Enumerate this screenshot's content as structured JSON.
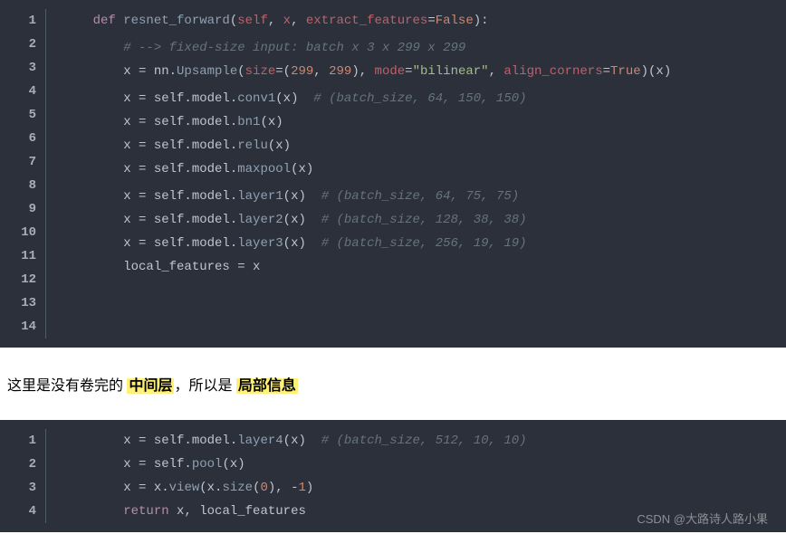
{
  "block1": {
    "gutter": [
      "1",
      "2",
      "3",
      "4",
      "5",
      "6",
      "7",
      "8",
      "9",
      "10",
      "11",
      "12",
      "13",
      "14"
    ],
    "lines": [
      [
        {
          "cls": "tok-default",
          "t": "    "
        },
        {
          "cls": "tok-kw",
          "t": "def "
        },
        {
          "cls": "tok-fn",
          "t": "resnet_forward"
        },
        {
          "cls": "tok-default",
          "t": "("
        },
        {
          "cls": "tok-var",
          "t": "self"
        },
        {
          "cls": "tok-default",
          "t": ", "
        },
        {
          "cls": "tok-var",
          "t": "x"
        },
        {
          "cls": "tok-default",
          "t": ", "
        },
        {
          "cls": "tok-var",
          "t": "extract_features"
        },
        {
          "cls": "tok-op",
          "t": "="
        },
        {
          "cls": "tok-bool",
          "t": "False"
        },
        {
          "cls": "tok-default",
          "t": "):"
        }
      ],
      [
        {
          "cls": "tok-default",
          "t": ""
        }
      ],
      [
        {
          "cls": "tok-default",
          "t": "        "
        },
        {
          "cls": "tok-com",
          "t": "# --> fixed-size input: batch x 3 x 299 x 299"
        }
      ],
      [
        {
          "cls": "tok-default",
          "t": "        x "
        },
        {
          "cls": "tok-op",
          "t": "="
        },
        {
          "cls": "tok-default",
          "t": " nn."
        },
        {
          "cls": "tok-call",
          "t": "Upsample"
        },
        {
          "cls": "tok-default",
          "t": "("
        },
        {
          "cls": "tok-var",
          "t": "size"
        },
        {
          "cls": "tok-op",
          "t": "="
        },
        {
          "cls": "tok-default",
          "t": "("
        },
        {
          "cls": "tok-num",
          "t": "299"
        },
        {
          "cls": "tok-default",
          "t": ", "
        },
        {
          "cls": "tok-num",
          "t": "299"
        },
        {
          "cls": "tok-default",
          "t": "), "
        },
        {
          "cls": "tok-var",
          "t": "mode"
        },
        {
          "cls": "tok-op",
          "t": "="
        },
        {
          "cls": "tok-str",
          "t": "\"bilinear\""
        },
        {
          "cls": "tok-default",
          "t": ", "
        },
        {
          "cls": "tok-var",
          "t": "align_corners"
        },
        {
          "cls": "tok-op",
          "t": "="
        },
        {
          "cls": "tok-bool",
          "t": "True"
        },
        {
          "cls": "tok-default",
          "t": ")(x)"
        }
      ],
      [
        {
          "cls": "tok-default",
          "t": ""
        }
      ],
      [
        {
          "cls": "tok-default",
          "t": "        x "
        },
        {
          "cls": "tok-op",
          "t": "="
        },
        {
          "cls": "tok-default",
          "t": " self.model."
        },
        {
          "cls": "tok-call",
          "t": "conv1"
        },
        {
          "cls": "tok-default",
          "t": "(x)  "
        },
        {
          "cls": "tok-com",
          "t": "# (batch_size, 64, 150, 150)"
        }
      ],
      [
        {
          "cls": "tok-default",
          "t": "        x "
        },
        {
          "cls": "tok-op",
          "t": "="
        },
        {
          "cls": "tok-default",
          "t": " self.model."
        },
        {
          "cls": "tok-call",
          "t": "bn1"
        },
        {
          "cls": "tok-default",
          "t": "(x)"
        }
      ],
      [
        {
          "cls": "tok-default",
          "t": "        x "
        },
        {
          "cls": "tok-op",
          "t": "="
        },
        {
          "cls": "tok-default",
          "t": " self.model."
        },
        {
          "cls": "tok-call",
          "t": "relu"
        },
        {
          "cls": "tok-default",
          "t": "(x)"
        }
      ],
      [
        {
          "cls": "tok-default",
          "t": "        x "
        },
        {
          "cls": "tok-op",
          "t": "="
        },
        {
          "cls": "tok-default",
          "t": " self.model."
        },
        {
          "cls": "tok-call",
          "t": "maxpool"
        },
        {
          "cls": "tok-default",
          "t": "(x)"
        }
      ],
      [
        {
          "cls": "tok-default",
          "t": ""
        }
      ],
      [
        {
          "cls": "tok-default",
          "t": "        x "
        },
        {
          "cls": "tok-op",
          "t": "="
        },
        {
          "cls": "tok-default",
          "t": " self.model."
        },
        {
          "cls": "tok-call",
          "t": "layer1"
        },
        {
          "cls": "tok-default",
          "t": "(x)  "
        },
        {
          "cls": "tok-com",
          "t": "# (batch_size, 64, 75, 75)"
        }
      ],
      [
        {
          "cls": "tok-default",
          "t": "        x "
        },
        {
          "cls": "tok-op",
          "t": "="
        },
        {
          "cls": "tok-default",
          "t": " self.model."
        },
        {
          "cls": "tok-call",
          "t": "layer2"
        },
        {
          "cls": "tok-default",
          "t": "(x)  "
        },
        {
          "cls": "tok-com",
          "t": "# (batch_size, 128, 38, 38)"
        }
      ],
      [
        {
          "cls": "tok-default",
          "t": "        x "
        },
        {
          "cls": "tok-op",
          "t": "="
        },
        {
          "cls": "tok-default",
          "t": " self.model."
        },
        {
          "cls": "tok-call",
          "t": "layer3"
        },
        {
          "cls": "tok-default",
          "t": "(x)  "
        },
        {
          "cls": "tok-com",
          "t": "# (batch_size, 256, 19, 19)"
        }
      ],
      [
        {
          "cls": "tok-default",
          "t": "        local_features "
        },
        {
          "cls": "tok-op",
          "t": "="
        },
        {
          "cls": "tok-default",
          "t": " x"
        }
      ]
    ]
  },
  "middle": {
    "t1": "这里是没有卷完的 ",
    "hl1": "中间层",
    "t2": "，所以是 ",
    "hl2": "局部信息"
  },
  "block2": {
    "gutter": [
      "1",
      "2",
      "3",
      "4"
    ],
    "lines": [
      [
        {
          "cls": "tok-default",
          "t": "        x "
        },
        {
          "cls": "tok-op",
          "t": "="
        },
        {
          "cls": "tok-default",
          "t": " self.model."
        },
        {
          "cls": "tok-call",
          "t": "layer4"
        },
        {
          "cls": "tok-default",
          "t": "(x)  "
        },
        {
          "cls": "tok-com",
          "t": "# (batch_size, 512, 10, 10)"
        }
      ],
      [
        {
          "cls": "tok-default",
          "t": "        x "
        },
        {
          "cls": "tok-op",
          "t": "="
        },
        {
          "cls": "tok-default",
          "t": " self."
        },
        {
          "cls": "tok-call",
          "t": "pool"
        },
        {
          "cls": "tok-default",
          "t": "(x)"
        }
      ],
      [
        {
          "cls": "tok-default",
          "t": "        x "
        },
        {
          "cls": "tok-op",
          "t": "="
        },
        {
          "cls": "tok-default",
          "t": " x."
        },
        {
          "cls": "tok-call",
          "t": "view"
        },
        {
          "cls": "tok-default",
          "t": "(x."
        },
        {
          "cls": "tok-call",
          "t": "size"
        },
        {
          "cls": "tok-default",
          "t": "("
        },
        {
          "cls": "tok-num",
          "t": "0"
        },
        {
          "cls": "tok-default",
          "t": "), "
        },
        {
          "cls": "tok-op",
          "t": "-"
        },
        {
          "cls": "tok-num",
          "t": "1"
        },
        {
          "cls": "tok-default",
          "t": ")"
        }
      ],
      [
        {
          "cls": "tok-default",
          "t": "        "
        },
        {
          "cls": "tok-kw",
          "t": "return"
        },
        {
          "cls": "tok-default",
          "t": " x, local_features"
        }
      ]
    ]
  },
  "watermark": "CSDN @大路诗人路小果"
}
